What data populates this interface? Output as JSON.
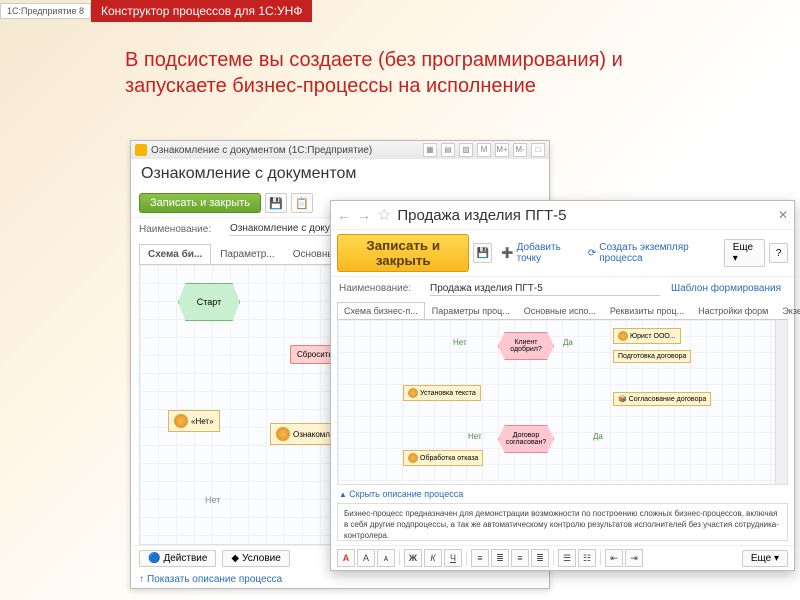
{
  "topbar": {
    "app_tag": "1С:Предприятие 8",
    "banner": "Конструктор процессов для 1С:УНФ"
  },
  "headline": "В подсистеме вы создаете (без программирования) и запускаете бизнес-процессы на исполнение",
  "win1": {
    "titlebar": "Ознакомление с документом (1С:Предприятие)",
    "title": "Ознакомление с документом",
    "save_close": "Записать и закрыть",
    "name_lbl": "Наименование:",
    "name_val": "Ознакомление с докуме",
    "tabs": [
      "Схема би...",
      "Параметр...",
      "Основны"
    ],
    "start": "Старт",
    "node_reset": "Сбросить состояние",
    "node_net": "«Нет»",
    "node_review": "Ознакомл докумен",
    "cond_net": "Нет",
    "btn_action": "Действие",
    "btn_cond": "Условие",
    "show_desc": "Показать описание процесса"
  },
  "win2": {
    "title": "Продажа изделия ПГТ-5",
    "save_close": "Записать и закрыть",
    "add_point": "Добавить точку",
    "create_inst": "Создать экземпляр процесса",
    "more": "Еще",
    "name_lbl": "Наименование:",
    "name_val": "Продажа изделия ПГТ-5",
    "template_lnk": "Шаблон формирования",
    "tabs": [
      "Схема бизнес-п...",
      "Параметры проц...",
      "Основные испо...",
      "Реквизиты проц...",
      "Настройки форм",
      "Экземпляры"
    ],
    "d_client": "Клиент одобрил?",
    "d_agreed": "Договор согласован?",
    "t_lawyer": "Юрист ООО...",
    "t_prepare": "Подготовка договора",
    "t_approve": "Согласование договора",
    "t_settext": "Установка текста",
    "t_reject": "Обработка отказа",
    "yes": "Да",
    "no": "Нет",
    "collapse": "Скрыть описание процесса",
    "description": "Бизнес-процесс предназначен для демонстрации возможности по построению сложных бизнес-процессов, включая в себя другие подпроцессы, а так же автоматическому контролю результатов исполнителей без участия сотрудника-контролера."
  }
}
